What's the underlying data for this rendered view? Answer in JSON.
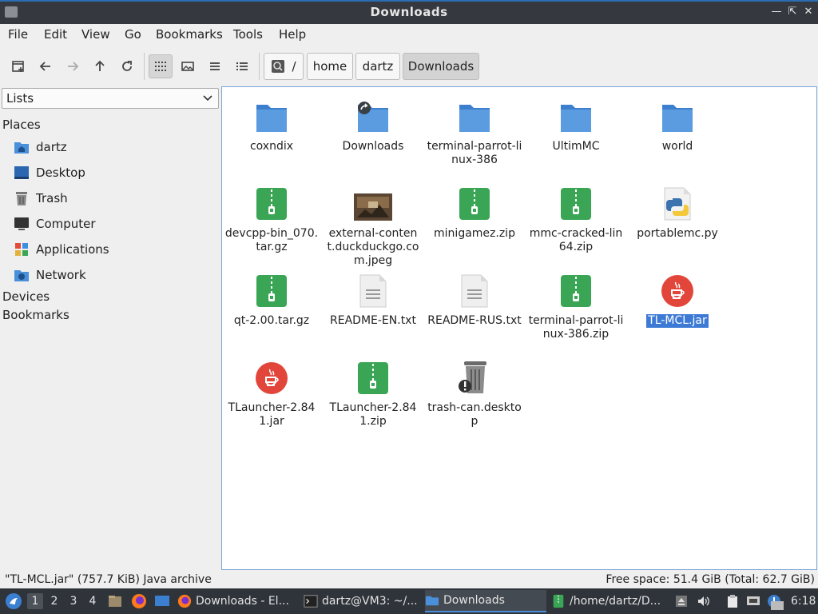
{
  "window": {
    "title": "Downloads"
  },
  "menu": [
    "File",
    "Edit",
    "View",
    "Go",
    "Bookmarks",
    "Tools",
    "Help"
  ],
  "path": {
    "root": "/",
    "crumbs": [
      "home",
      "dartz",
      "Downloads"
    ]
  },
  "sidebar": {
    "combo_value": "Lists",
    "places_label": "Places",
    "places": [
      "dartz",
      "Desktop",
      "Trash",
      "Computer",
      "Applications",
      "Network"
    ],
    "devices_label": "Devices",
    "bookmarks_label": "Bookmarks"
  },
  "files": [
    {
      "name": "coxndix",
      "type": "folder"
    },
    {
      "name": "Downloads",
      "type": "folder-link"
    },
    {
      "name": "terminal-parrot-linux-386",
      "type": "folder"
    },
    {
      "name": "UltimMC",
      "type": "folder"
    },
    {
      "name": "world",
      "type": "folder"
    },
    {
      "name": "devcpp-bin_070.tar.gz",
      "type": "archive"
    },
    {
      "name": "external-content.duckduckgo.com.jpeg",
      "type": "image"
    },
    {
      "name": "minigamez.zip",
      "type": "archive"
    },
    {
      "name": "mmc-cracked-lin64.zip",
      "type": "archive"
    },
    {
      "name": "portablemc.py",
      "type": "python"
    },
    {
      "name": "qt-2.00.tar.gz",
      "type": "archive"
    },
    {
      "name": "README-EN.txt",
      "type": "text"
    },
    {
      "name": "README-RUS.txt",
      "type": "text"
    },
    {
      "name": "terminal-parrot-linux-386.zip",
      "type": "archive"
    },
    {
      "name": "TL-MCL.jar",
      "type": "java",
      "selected": true
    },
    {
      "name": "TLauncher-2.841.jar",
      "type": "java"
    },
    {
      "name": "TLauncher-2.841.zip",
      "type": "archive"
    },
    {
      "name": "trash-can.desktop",
      "type": "desktop"
    }
  ],
  "status": {
    "left": "\"TL-MCL.jar\" (757.7 KiB) Java archive",
    "right": "Free space: 51.4 GiB (Total: 62.7 GiB)"
  },
  "taskbar": {
    "workspaces": [
      "1",
      "2",
      "3",
      "4"
    ],
    "tasks": [
      "Downloads - El...",
      "dartz@VM3: ~/...",
      "Downloads",
      "/home/dartz/D..."
    ],
    "clock": "6:18"
  },
  "colors": {
    "accent": "#3d7ad6",
    "folder": "#4a8fd9",
    "archive": "#3aa655",
    "java": "#e2463a"
  }
}
